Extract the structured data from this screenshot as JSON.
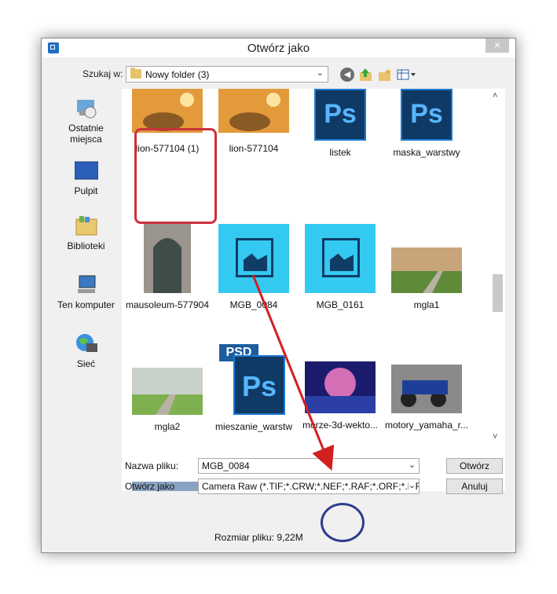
{
  "window": {
    "title": "Otwórz jako",
    "close_glyph": "×"
  },
  "lookin": {
    "label": "Szukaj w:",
    "value": "Nowy folder (3)",
    "arrow": "⌄"
  },
  "toolbar": {
    "back": "back-icon",
    "up": "up-folder-icon",
    "new": "new-folder-icon",
    "view": "view-menu-icon"
  },
  "places": [
    {
      "label": "Ostatnie\nmiejsca"
    },
    {
      "label": "Pulpit"
    },
    {
      "label": "Biblioteki"
    },
    {
      "label": "Ten komputer"
    },
    {
      "label": "Sieć"
    }
  ],
  "files": [
    {
      "name": "lion-577104 (1)",
      "kind": "photo-lion"
    },
    {
      "name": "lion-577104",
      "kind": "photo-lion"
    },
    {
      "name": "listek",
      "kind": "ps"
    },
    {
      "name": "maska_warstwy",
      "kind": "ps"
    },
    {
      "name": "mausoleum-577904",
      "kind": "photo-door"
    },
    {
      "name": "MGB_0084",
      "kind": "generic"
    },
    {
      "name": "MGB_0161",
      "kind": "generic"
    },
    {
      "name": "mgla1",
      "kind": "photo-field"
    },
    {
      "name": "mgla2",
      "kind": "photo-field2"
    },
    {
      "name": "mieszanie_warstw",
      "kind": "psd"
    },
    {
      "name": "morze-3d-wekto...",
      "kind": "photo-sea"
    },
    {
      "name": "motory_yamaha_r...",
      "kind": "photo-moto"
    }
  ],
  "icons": {
    "ps_text": "Ps",
    "psd_text": "PSD"
  },
  "scroll": {
    "up": "˄",
    "down": "˅"
  },
  "form": {
    "filename_label": "Nazwa pliku:",
    "filename_value": "MGB_0084",
    "openas_label": "Otwórz jako",
    "openas_value": "Camera Raw (*.TIF;*.CRW;*.NEF;*.RAF;*.ORF;*.MRW",
    "arrow": "⌄"
  },
  "buttons": {
    "open": "Otwórz",
    "cancel": "Anuluj"
  },
  "filesize": "Rozmiar pliku: 9,22M",
  "colors": {
    "annot_red": "#c9323a",
    "annot_blue": "#2e3c8e",
    "ps_dark": "#0f3a65",
    "ps_accent": "#58b6ff"
  }
}
